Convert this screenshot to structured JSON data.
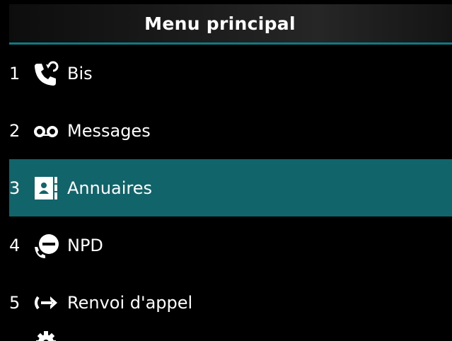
{
  "header": {
    "title": "Menu principal"
  },
  "menu": {
    "selected_index": 2,
    "items": [
      {
        "number": "1",
        "label": "Bis",
        "icon": "redial-icon"
      },
      {
        "number": "2",
        "label": "Messages",
        "icon": "voicemail-icon"
      },
      {
        "number": "3",
        "label": "Annuaires",
        "icon": "directory-icon"
      },
      {
        "number": "4",
        "label": "NPD",
        "icon": "do-not-disturb-icon"
      },
      {
        "number": "5",
        "label": "Renvoi d'appel",
        "icon": "call-forward-icon"
      }
    ],
    "partial_item_icon": "settings-icon"
  },
  "colors": {
    "background": "#000000",
    "header_line": "#0f7a84",
    "selected_row": "#12646b",
    "text": "#ffffff"
  }
}
